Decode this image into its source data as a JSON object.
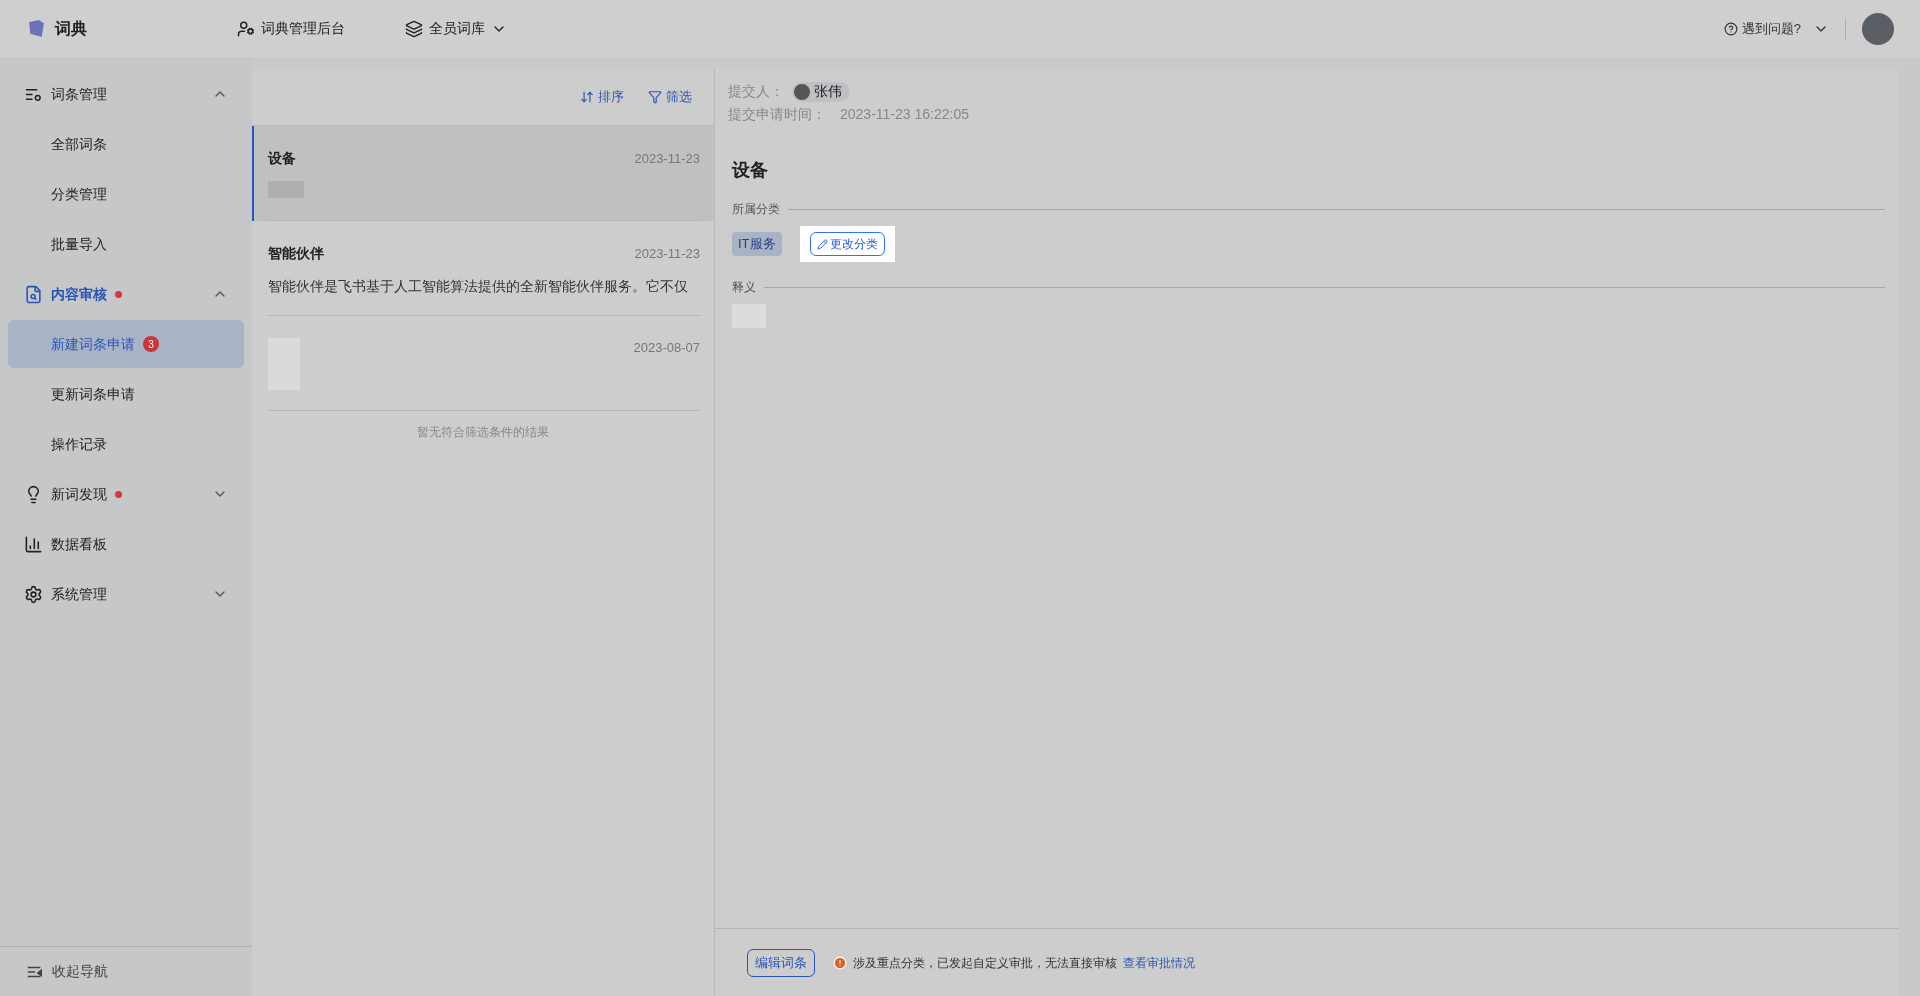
{
  "app": {
    "name": "词典"
  },
  "top_nav": [
    {
      "label": "词典管理后台",
      "kind": "link"
    },
    {
      "label": "全员词库",
      "kind": "dropdown"
    }
  ],
  "help": {
    "label": "遇到问题?"
  },
  "sidebar": {
    "items": [
      {
        "label": "词条管理",
        "active": false,
        "expanded": true,
        "children": [
          {
            "label": "全部词条",
            "selected": false
          },
          {
            "label": "分类管理",
            "selected": false
          },
          {
            "label": "批量导入",
            "selected": false
          }
        ]
      },
      {
        "label": "内容审核",
        "active": true,
        "expanded": true,
        "dot": true,
        "children": [
          {
            "label": "新建词条申请",
            "selected": true,
            "badge": "3"
          },
          {
            "label": "更新词条申请",
            "selected": false
          },
          {
            "label": "操作记录",
            "selected": false
          }
        ]
      },
      {
        "label": "新词发现",
        "active": false,
        "expanded": false,
        "dot": true
      },
      {
        "label": "数据看板",
        "active": false
      },
      {
        "label": "系统管理",
        "active": false,
        "expanded": false
      }
    ],
    "collapse_label": "收起导航"
  },
  "list": {
    "actions": [
      {
        "label": "排序"
      },
      {
        "label": "筛选"
      }
    ],
    "entries": [
      {
        "title": "设备",
        "date": "2023-11-23",
        "selected": true
      },
      {
        "title": "智能伙伴",
        "date": "2023-11-23",
        "snippet": "智能伙伴是飞书基于人工智能算法提供的全新智能伙伴服务。它不仅",
        "selected": false
      },
      {
        "date": "2023-08-07",
        "selected": false
      }
    ],
    "empty_note": "暂无符合筛选条件的结果"
  },
  "detail": {
    "submitter_label": "提交人：",
    "submitter": "张伟",
    "time_label": "提交申请时间：",
    "time": "2023-11-23 16:22:05",
    "title": "设备",
    "sections": [
      {
        "label": "所属分类",
        "tags": [
          "IT服务"
        ],
        "action": "更改分类"
      },
      {
        "label": "释义"
      }
    ]
  },
  "footer": {
    "button": "编辑词条",
    "notice": "涉及重点分类，已发起自定义审批，无法直接审核",
    "link": "查看审批情况"
  }
}
